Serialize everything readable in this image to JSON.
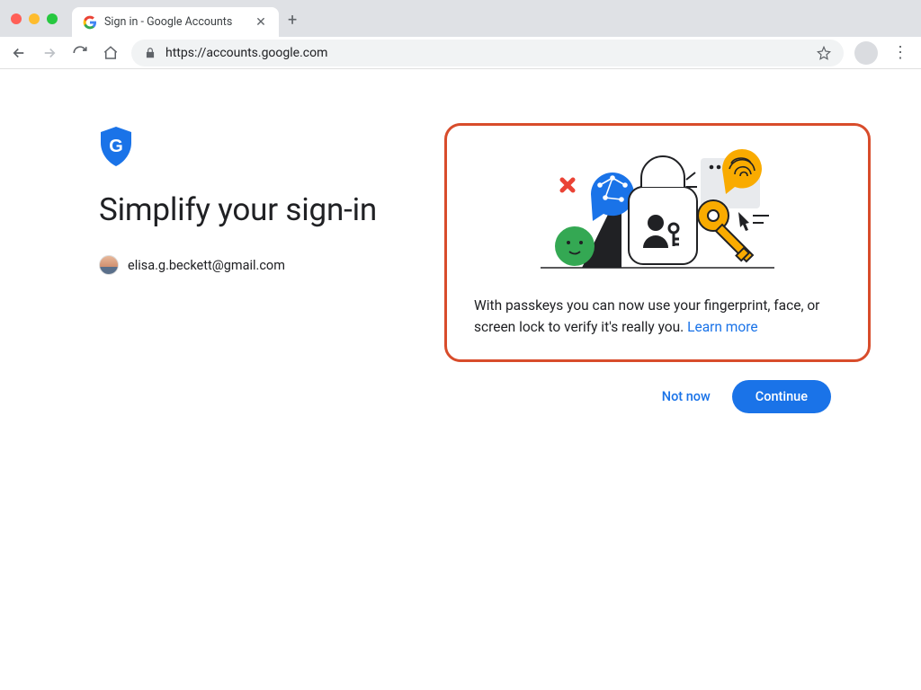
{
  "browser": {
    "tab": {
      "title": "Sign in - Google Accounts"
    },
    "url": "https://accounts.google.com"
  },
  "page": {
    "title": "Simplify your sign-in",
    "account_email": "elisa.g.beckett@gmail.com",
    "card": {
      "body": "With passkeys you can now use your fingerprint, face, or screen lock to verify it's really you.",
      "learn_more": "Learn more"
    },
    "actions": {
      "not_now": "Not now",
      "continue": "Continue"
    }
  },
  "colors": {
    "accent_blue": "#1a73e8",
    "highlight_border": "#d84c2b"
  }
}
